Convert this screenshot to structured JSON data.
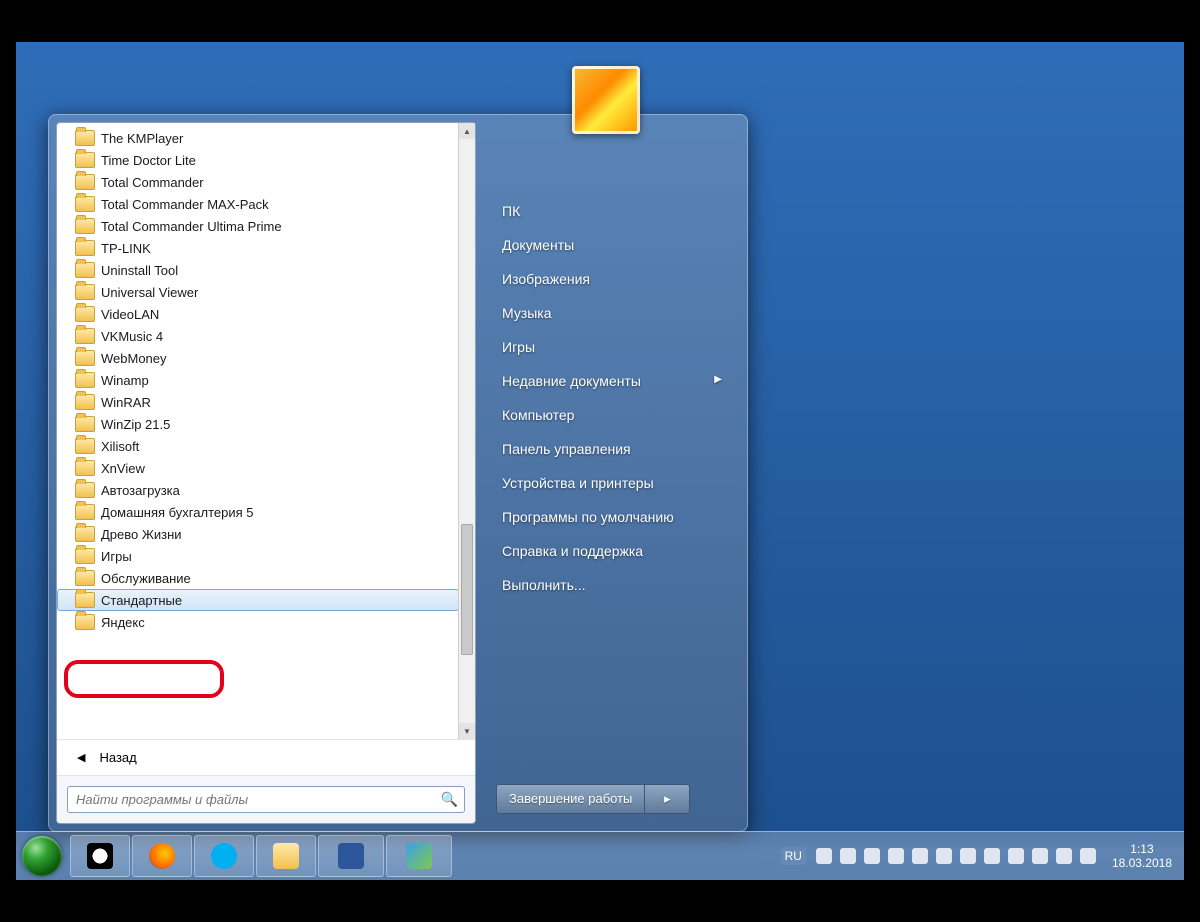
{
  "programs": [
    "The KMPlayer",
    "Time Doctor Lite",
    "Total Commander",
    "Total Commander MAX-Pack",
    "Total Commander Ultima Prime",
    "TP-LINK",
    "Uninstall Tool",
    "Universal Viewer",
    "VideoLAN",
    "VKMusic 4",
    "WebMoney",
    "Winamp",
    "WinRAR",
    "WinZip 21.5",
    "Xilisoft",
    "XnView",
    "Автозагрузка",
    "Домашняя бухгалтерия 5",
    "Древо Жизни",
    "Игры",
    "Обслуживание",
    "Стандартные",
    "Яндекс"
  ],
  "selected_program": "Стандартные",
  "back_label": "Назад",
  "search_placeholder": "Найти программы и файлы",
  "right_links": [
    {
      "label": "ПК",
      "arrow": false
    },
    {
      "label": "Документы",
      "arrow": false
    },
    {
      "label": "Изображения",
      "arrow": false
    },
    {
      "label": "Музыка",
      "arrow": false
    },
    {
      "label": "Игры",
      "arrow": false
    },
    {
      "label": "Недавние документы",
      "arrow": true
    },
    {
      "label": "Компьютер",
      "arrow": false
    },
    {
      "label": "Панель управления",
      "arrow": false
    },
    {
      "label": "Устройства и принтеры",
      "arrow": false
    },
    {
      "label": "Программы по умолчанию",
      "arrow": false
    },
    {
      "label": "Справка и поддержка",
      "arrow": false
    },
    {
      "label": "Выполнить...",
      "arrow": false
    }
  ],
  "shutdown_label": "Завершение работы",
  "tray": {
    "lang": "RU",
    "time": "1:13",
    "date": "18.03.2018"
  }
}
